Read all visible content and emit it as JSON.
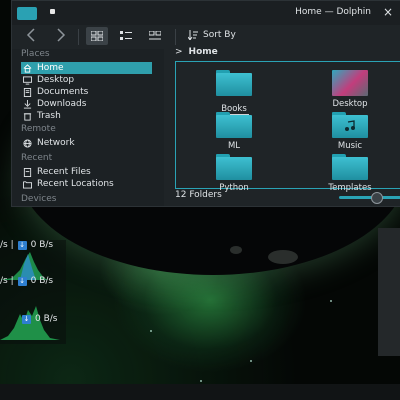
{
  "window": {
    "title": "Home — Dolphin",
    "close_glyph": "×"
  },
  "toolbar": {
    "back_icon": "chevron-left-icon",
    "forward_icon": "chevron-right-icon",
    "sort_label": "Sort By"
  },
  "sidebar": {
    "places_header": "Places",
    "places": [
      {
        "label": "Home",
        "icon": "home-icon"
      },
      {
        "label": "Desktop",
        "icon": "desktop-icon"
      },
      {
        "label": "Documents",
        "icon": "documents-icon"
      },
      {
        "label": "Downloads",
        "icon": "downloads-icon"
      },
      {
        "label": "Trash",
        "icon": "trash-icon"
      }
    ],
    "remote_header": "Remote",
    "remote": [
      {
        "label": "Network",
        "icon": "network-icon"
      }
    ],
    "recent_header": "Recent",
    "recent": [
      {
        "label": "Recent Files",
        "icon": "recent-files-icon"
      },
      {
        "label": "Recent Locations",
        "icon": "recent-locations-icon"
      }
    ],
    "devices_header": "Devices"
  },
  "breadcrumb": {
    "separator": ">",
    "current": "Home"
  },
  "folders": [
    {
      "label": "Books"
    },
    {
      "label": "Desktop"
    },
    {
      "label": "ML"
    },
    {
      "label": "Music"
    },
    {
      "label": "Python"
    },
    {
      "label": "Templates"
    }
  ],
  "status": {
    "count": "12 Folders"
  },
  "monitor": {
    "row1": "/s  |",
    "row1_value": "0 B/s",
    "row2": "/s  |",
    "row2_value": "0 B/s",
    "row3_value": "0 B/s"
  },
  "colors": {
    "accent": "#2f9fac",
    "folder": "#3ec0d1"
  }
}
